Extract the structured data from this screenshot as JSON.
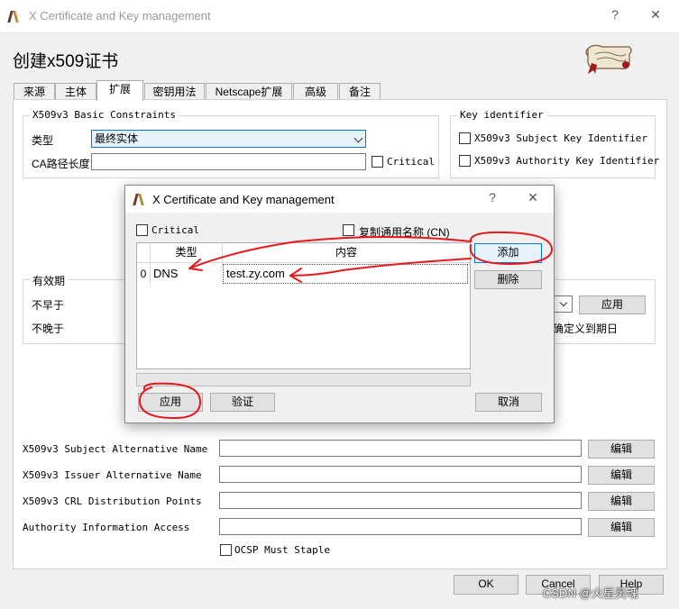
{
  "window": {
    "title": "X Certificate and Key management",
    "help_label": "?",
    "close_label": "✕",
    "heading": "创建x509证书"
  },
  "tabs": [
    "来源",
    "主体",
    "扩展",
    "密钥用法",
    "Netscape扩展",
    "高级",
    "备注"
  ],
  "basic_constraints": {
    "legend": "X509v3 Basic Constraints",
    "type_label": "类型",
    "type_value": "最终实体",
    "path_len_label": "CA路径长度",
    "path_len_value": "",
    "critical_label": "Critical"
  },
  "key_identifier": {
    "legend": "Key identifier",
    "subject_key_label": "X509v3 Subject Key Identifier",
    "authority_key_label": "X509v3 Authority Key Identifier"
  },
  "validity": {
    "legend": "有效期",
    "not_before_label": "不早于",
    "not_after_label": "不晚于",
    "apply_label": "应用",
    "partial_text": "确定义到期日"
  },
  "extensions": {
    "rows": [
      {
        "label": "X509v3 Subject Alternative Name",
        "value": "",
        "button": "编辑"
      },
      {
        "label": "X509v3 Issuer Alternative Name",
        "value": "",
        "button": "编辑"
      },
      {
        "label": "X509v3 CRL Distribution Points",
        "value": "",
        "button": "编辑"
      },
      {
        "label": "Authority Information Access",
        "value": "",
        "button": "编辑"
      }
    ],
    "ocsp_label": "OCSP Must Staple"
  },
  "footer": {
    "ok_label": "OK",
    "cancel_label": "Cancel",
    "help_label": "Help"
  },
  "dialog": {
    "title": "X Certificate and Key management",
    "help_label": "?",
    "close_label": "✕",
    "critical_label": "Critical",
    "copy_cn_label": "复制通用名称 (CN)",
    "table": {
      "headers": [
        "类型",
        "内容"
      ],
      "rows": [
        {
          "index": "0",
          "type": "DNS",
          "content": "test.zy.com"
        }
      ]
    },
    "add_label": "添加",
    "delete_label": "删除",
    "apply_label": "应用",
    "verify_label": "验证",
    "cancel_label": "取消"
  },
  "watermark": "CSDN @火星灵魂",
  "colors": {
    "accent": "#0078d7",
    "annotation": "#e8191c",
    "panel": "#ffffff",
    "chrome": "#f0f0f0"
  }
}
